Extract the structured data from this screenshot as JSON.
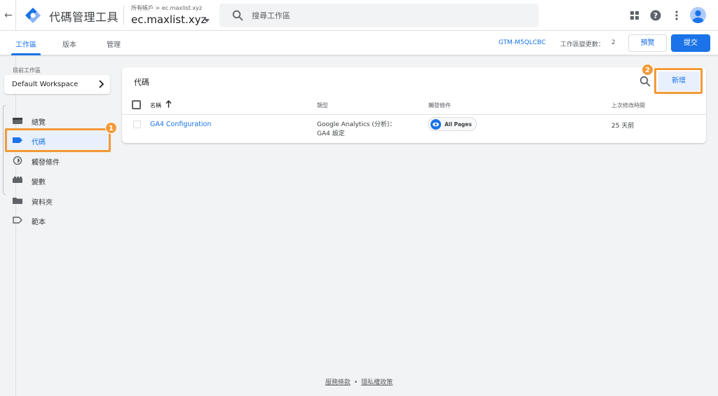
{
  "header": {
    "app_title": "代碼管理工具",
    "account_crumb": "所有帳戶 > ec.maxlist.xyz",
    "container_name": "ec.maxlist.xyz",
    "search_placeholder": "搜尋工作區"
  },
  "tabs": [
    {
      "label": "工作區",
      "active": true
    },
    {
      "label": "版本",
      "active": false
    },
    {
      "label": "管理",
      "active": false
    }
  ],
  "status": {
    "container_id": "GTM-M5QLCBC",
    "changes_label": "工作區變更數：",
    "changes_count": "2",
    "preview_label": "預覽",
    "submit_label": "提交"
  },
  "sidebar": {
    "workspace_label": "目前工作區",
    "workspace_name": "Default Workspace",
    "items": [
      {
        "label": "總覽",
        "icon": "overview-icon",
        "active": false
      },
      {
        "label": "代碼",
        "icon": "tag-icon",
        "active": true
      },
      {
        "label": "觸發條件",
        "icon": "trigger-icon",
        "active": false
      },
      {
        "label": "變數",
        "icon": "variable-icon",
        "active": false
      },
      {
        "label": "資料夾",
        "icon": "folder-icon",
        "active": false
      },
      {
        "label": "範本",
        "icon": "template-icon",
        "active": false
      }
    ]
  },
  "annotations": {
    "badge_1": "1",
    "badge_2": "2",
    "color": "#f29a38"
  },
  "tags_card": {
    "title": "代碼",
    "new_label": "新增",
    "columns": {
      "name": "名稱",
      "type": "類型",
      "trigger": "觸發條件",
      "modified": "上次修改時間"
    },
    "rows": [
      {
        "name": "GA4 Configuration",
        "type": "Google Analytics (分析)：GA4 設定",
        "trigger": "All Pages",
        "modified": "25 天前"
      }
    ]
  },
  "footer": {
    "terms": "服務條款",
    "separator": "•",
    "privacy": "隱私權政策"
  },
  "colors": {
    "accent": "#1a73e8",
    "annotation": "#f29a38",
    "background": "#f1f3f4"
  }
}
